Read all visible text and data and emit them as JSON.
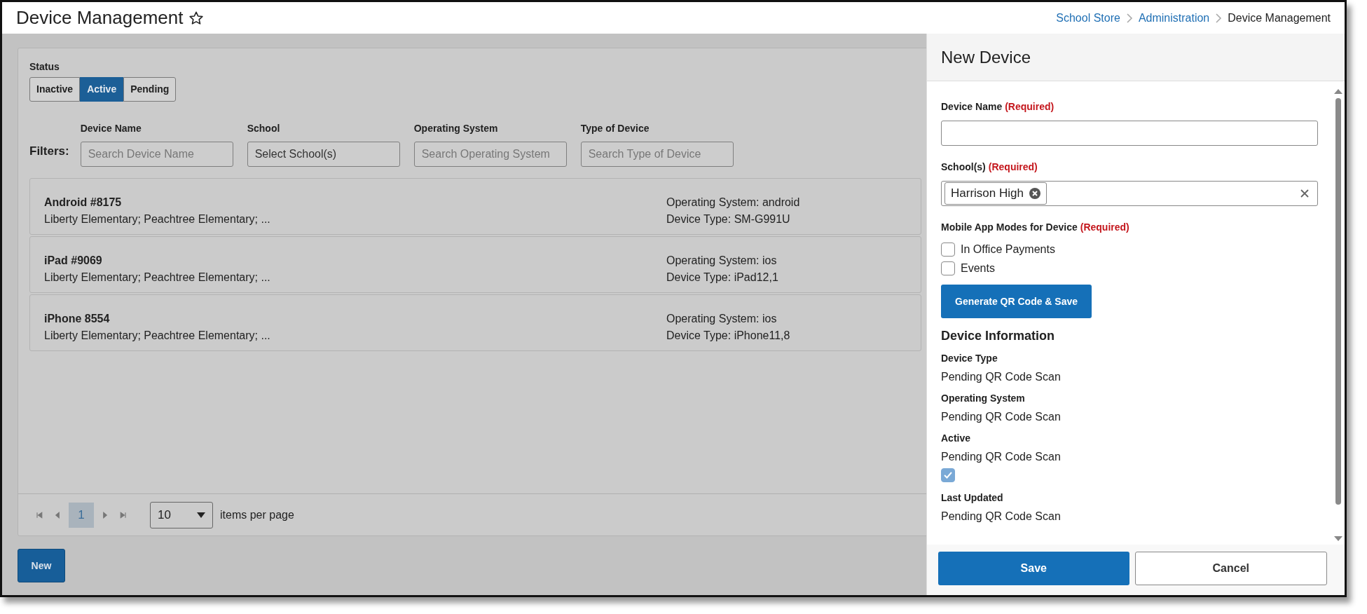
{
  "header": {
    "title": "Device Management",
    "breadcrumbs": [
      {
        "label": "School Store",
        "link": true
      },
      {
        "label": "Administration",
        "link": true
      },
      {
        "label": "Device Management",
        "link": false
      }
    ]
  },
  "status": {
    "label": "Status",
    "options": [
      {
        "label": "Inactive",
        "selected": false
      },
      {
        "label": "Active",
        "selected": true
      },
      {
        "label": "Pending",
        "selected": false
      }
    ]
  },
  "filters": {
    "label": "Filters:",
    "fields": [
      {
        "label": "Device Name",
        "placeholder": "Search Device Name"
      },
      {
        "label": "School",
        "value": "Select School(s)"
      },
      {
        "label": "Operating System",
        "placeholder": "Search Operating System"
      },
      {
        "label": "Type of Device",
        "placeholder": "Search Type of Device"
      }
    ]
  },
  "devices": [
    {
      "name": "Android #8175",
      "schools": "Liberty Elementary; Peachtree Elementary; ...",
      "os": "Operating System: android",
      "type": "Device Type: SM-G991U"
    },
    {
      "name": "iPad #9069",
      "schools": "Liberty Elementary; Peachtree Elementary; ...",
      "os": "Operating System: ios",
      "type": "Device Type: iPad12,1"
    },
    {
      "name": "iPhone 8554",
      "schools": "Liberty Elementary; Peachtree Elementary; ...",
      "os": "Operating System: ios",
      "type": "Device Type: iPhone11,8"
    }
  ],
  "pagination": {
    "page": "1",
    "page_size": "10",
    "suffix": "items per page"
  },
  "new_button": "New",
  "panel": {
    "title": "New Device",
    "device_name": {
      "label": "Device Name",
      "required": "(Required)"
    },
    "schools": {
      "label": "School(s)",
      "required": "(Required)",
      "tags": [
        "Harrison High"
      ]
    },
    "modes": {
      "label": "Mobile App Modes for Device",
      "required": "(Required)",
      "options": [
        {
          "label": "In Office Payments",
          "checked": false
        },
        {
          "label": "Events",
          "checked": false
        }
      ]
    },
    "generate_button": "Generate QR Code & Save",
    "info_title": "Device Information",
    "info": [
      {
        "label": "Device Type",
        "value": "Pending QR Code Scan"
      },
      {
        "label": "Operating System",
        "value": "Pending QR Code Scan"
      },
      {
        "label": "Active",
        "value": "Pending QR Code Scan",
        "checked": true
      },
      {
        "label": "Last Updated",
        "value": "Pending QR Code Scan"
      }
    ],
    "save": "Save",
    "cancel": "Cancel"
  }
}
